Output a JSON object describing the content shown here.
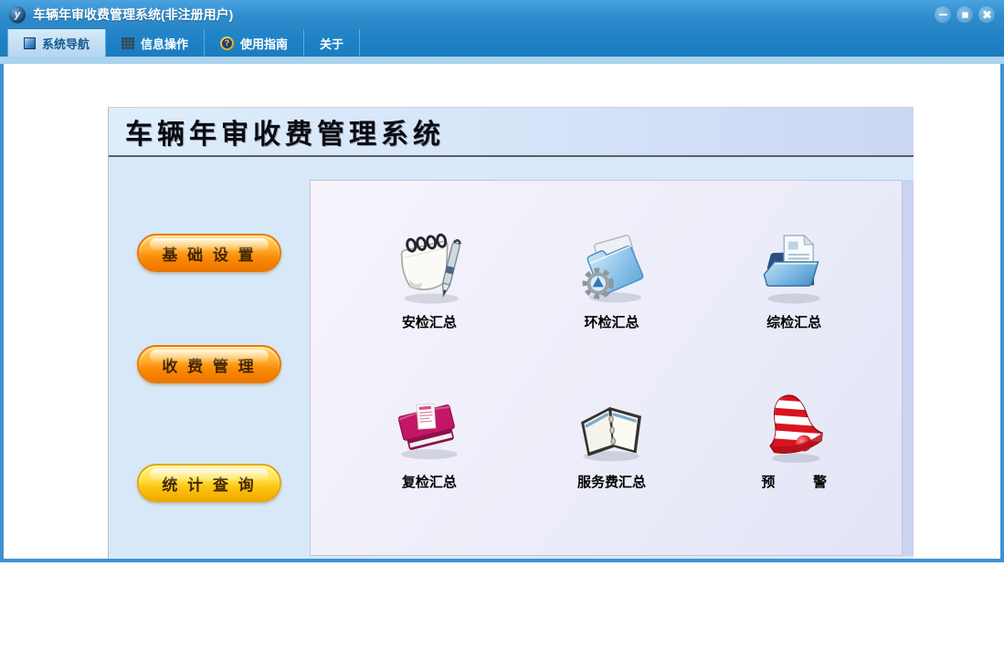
{
  "window": {
    "title": "车辆年审收费管理系统(非注册用户)",
    "logo_text": "y"
  },
  "tabs": [
    {
      "label": "系统导航",
      "icon": "window-icon",
      "active": true
    },
    {
      "label": "信息操作",
      "icon": "grid-icon",
      "active": false
    },
    {
      "label": "使用指南",
      "icon": "help-icon",
      "active": false
    },
    {
      "label": "关于",
      "icon": "",
      "active": false
    }
  ],
  "icons": {
    "help_glyph": "?"
  },
  "panel": {
    "heading": "车辆年审收费管理系统",
    "nav_buttons": [
      {
        "label": "基 础 设 置"
      },
      {
        "label": "收 费 管 理"
      },
      {
        "label": "统 计 查 询"
      }
    ],
    "shortcuts": [
      {
        "label": "安检汇总",
        "icon": "notepad-pen-icon"
      },
      {
        "label": "环检汇总",
        "icon": "folder-gear-icon"
      },
      {
        "label": "综检汇总",
        "icon": "folder-document-icon"
      },
      {
        "label": "复检汇总",
        "icon": "book-note-icon"
      },
      {
        "label": "服务费汇总",
        "icon": "open-binder-icon"
      },
      {
        "label": "预          警",
        "icon": "alert-bell-icon"
      }
    ]
  },
  "colors": {
    "titlebar_blue": "#2f8dcd",
    "tabbar_blue": "#1b7cc0",
    "active_tab_bg": "#b3d7ef",
    "panel_blue": "#d7e9f9",
    "inner_panel_lavender": "#ecedf9",
    "button_orange": "#f88d07",
    "button_gold": "#fbc514",
    "alert_red": "#d81420"
  }
}
